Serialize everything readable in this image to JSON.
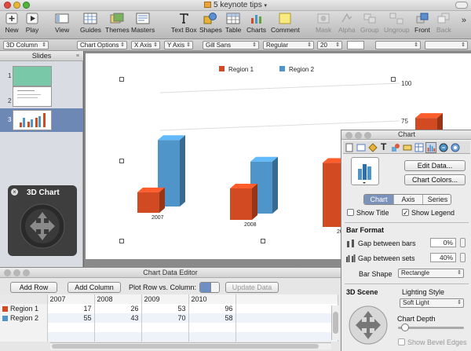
{
  "window": {
    "title": "5 keynote tips",
    "lights": [
      "#e0493e",
      "#e4b63a",
      "#4fb43c"
    ]
  },
  "toolbar": {
    "new": "New",
    "play": "Play",
    "view": "View",
    "guides": "Guides",
    "themes": "Themes",
    "masters": "Masters",
    "text_box": "Text Box",
    "shapes": "Shapes",
    "table": "Table",
    "charts": "Charts",
    "comment": "Comment",
    "mask": "Mask",
    "alpha": "Alpha",
    "group": "Group",
    "ungroup": "Ungroup",
    "front": "Front",
    "back": "Back"
  },
  "formatbar": {
    "chart_type": "3D Column",
    "chart_options": "Chart Options",
    "x_axis": "X Axis",
    "y_axis": "Y Axis",
    "font": "Gill Sans",
    "style": "Regular",
    "size": "20"
  },
  "slides": {
    "header": "Slides",
    "items": [
      {
        "num": "1"
      },
      {
        "num": "2"
      },
      {
        "num": "3"
      }
    ],
    "selected": 3
  },
  "hud": {
    "title": "3D Chart"
  },
  "chart_data": {
    "type": "bar",
    "categories": [
      "2007",
      "2008",
      "2009",
      "2010"
    ],
    "series": [
      {
        "name": "Region 1",
        "color": "#d24a22",
        "values": [
          17,
          26,
          53,
          96
        ]
      },
      {
        "name": "Region 2",
        "color": "#4f95c9",
        "values": [
          55,
          43,
          70,
          58
        ]
      }
    ],
    "ylim": [
      0,
      100
    ],
    "ticks": [
      "100",
      "75"
    ],
    "legend": "top-center"
  },
  "editor": {
    "title": "Chart Data Editor",
    "add_row": "Add Row",
    "add_column": "Add Column",
    "plot_label": "Plot Row vs. Column:",
    "update": "Update Data",
    "columns": [
      "2007",
      "2008",
      "2009",
      "2010"
    ],
    "rows": [
      {
        "name": "Region 1",
        "color": "#d24a22",
        "values": [
          "17",
          "26",
          "53",
          "96"
        ]
      },
      {
        "name": "Region 2",
        "color": "#4f95c9",
        "values": [
          "55",
          "43",
          "70",
          "58"
        ]
      }
    ]
  },
  "inspector": {
    "title": "Chart",
    "edit_data": "Edit Data...",
    "chart_colors": "Chart Colors...",
    "tabs": [
      "Chart",
      "Axis",
      "Series"
    ],
    "show_title": "Show Title",
    "show_legend": "Show Legend",
    "bar_format": "Bar Format",
    "gap_bars": "Gap between bars",
    "gap_bars_val": "0%",
    "gap_sets": "Gap between sets",
    "gap_sets_val": "40%",
    "bar_shape_label": "Bar Shape",
    "bar_shape": "Rectangle",
    "scene_3d": "3D Scene",
    "lighting_label": "Lighting Style",
    "lighting": "Soft Light",
    "depth_label": "Chart Depth",
    "bevel": "Show Bevel Edges"
  }
}
